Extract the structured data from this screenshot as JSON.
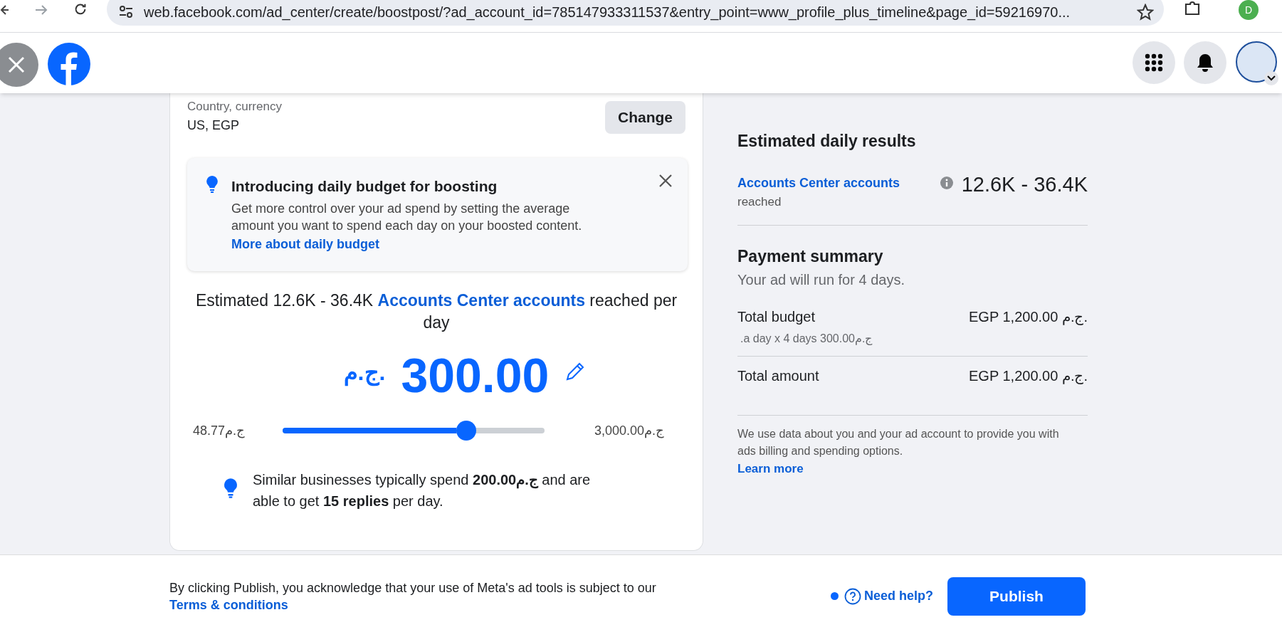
{
  "browser": {
    "url": "web.facebook.com/ad_center/create/boostpost/?ad_account_id=785147933311537&entry_point=www_profile_plus_timeline&page_id=59216970...",
    "profile_initial": "D"
  },
  "country": {
    "label": "Country, currency",
    "value": "US, EGP",
    "button": "Change"
  },
  "notice": {
    "title": "Introducing daily budget for boosting",
    "body": "Get more control over your ad spend by setting the average amount you want to spend each day on your boosted content.",
    "link": "More about daily budget"
  },
  "estimate": {
    "before": "Estimated 12.6K - 36.4K",
    "link": "Accounts Center accounts",
    "after": "reached per day"
  },
  "budget": {
    "currency_symbol": "ج.م.",
    "amount": "300.00",
    "min": "48.77ج.م",
    "max": "3,000.00ج.م",
    "level": 0.7
  },
  "tip": "Similar businesses typically spend **200.00ج.م** and are able to get **15 replies** per day.",
  "results": {
    "title": "Estimated daily results",
    "metric_link": "Accounts Center accounts",
    "metric_sub": "reached",
    "value": "12.6K - 36.4K"
  },
  "payment": {
    "title": "Payment summary",
    "subtitle": "Your ad will run for 4 days.",
    "rows": [
      {
        "label": "Total budget",
        "value": "EGP 1,200.00 ج.م.",
        "detail": ".a day x 4 days 300.00ج.م"
      },
      {
        "label": "Total amount",
        "value": "EGP 1,200.00 ج.م."
      }
    ],
    "disclaimer": "We use data about you and your ad account to provide you with ads billing and spending options.",
    "learn_more": "Learn more"
  },
  "footer": {
    "text": "By clicking Publish, you acknowledge that your use of Meta's ad tools is subject to our",
    "link": "Terms & conditions",
    "help": "Need help?",
    "publish": "Publish"
  }
}
